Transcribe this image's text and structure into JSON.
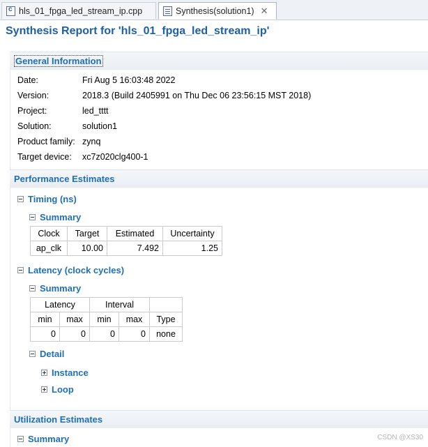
{
  "tabs": [
    {
      "label": "hls_01_fpga_led_stream_ip.cpp"
    },
    {
      "label": "Synthesis(solution1)",
      "close": "✕"
    }
  ],
  "title": "Synthesis Report for 'hls_01_fpga_led_stream_ip'",
  "general": {
    "heading": "General Information",
    "rows": [
      {
        "label": "Date:",
        "value": "Fri Aug 5 16:03:48 2022"
      },
      {
        "label": "Version:",
        "value": "2018.3 (Build 2405991 on Thu Dec 06 23:56:15 MST 2018)"
      },
      {
        "label": "Project:",
        "value": "led_tttt"
      },
      {
        "label": "Solution:",
        "value": "solution1"
      },
      {
        "label": "Product family:",
        "value": "zynq"
      },
      {
        "label": "Target device:",
        "value": "xc7z020clg400-1"
      }
    ]
  },
  "performance": {
    "heading": "Performance Estimates",
    "timing": {
      "heading": "Timing (ns)",
      "summary": "Summary",
      "headers": [
        "Clock",
        "Target",
        "Estimated",
        "Uncertainty"
      ],
      "row": [
        "ap_clk",
        "10.00",
        "7.492",
        "1.25"
      ]
    },
    "latency": {
      "heading": "Latency (clock cycles)",
      "summary": "Summary",
      "group_headers": [
        "Latency",
        "Interval",
        ""
      ],
      "headers": [
        "min",
        "max",
        "min",
        "max",
        "Type"
      ],
      "row": [
        "0",
        "0",
        "0",
        "0",
        "none"
      ],
      "detail": "Detail",
      "instance": "Instance",
      "loop": "Loop"
    }
  },
  "utilization": {
    "heading": "Utilization Estimates",
    "summary": "Summary"
  },
  "watermark": "CSDN @XS30"
}
